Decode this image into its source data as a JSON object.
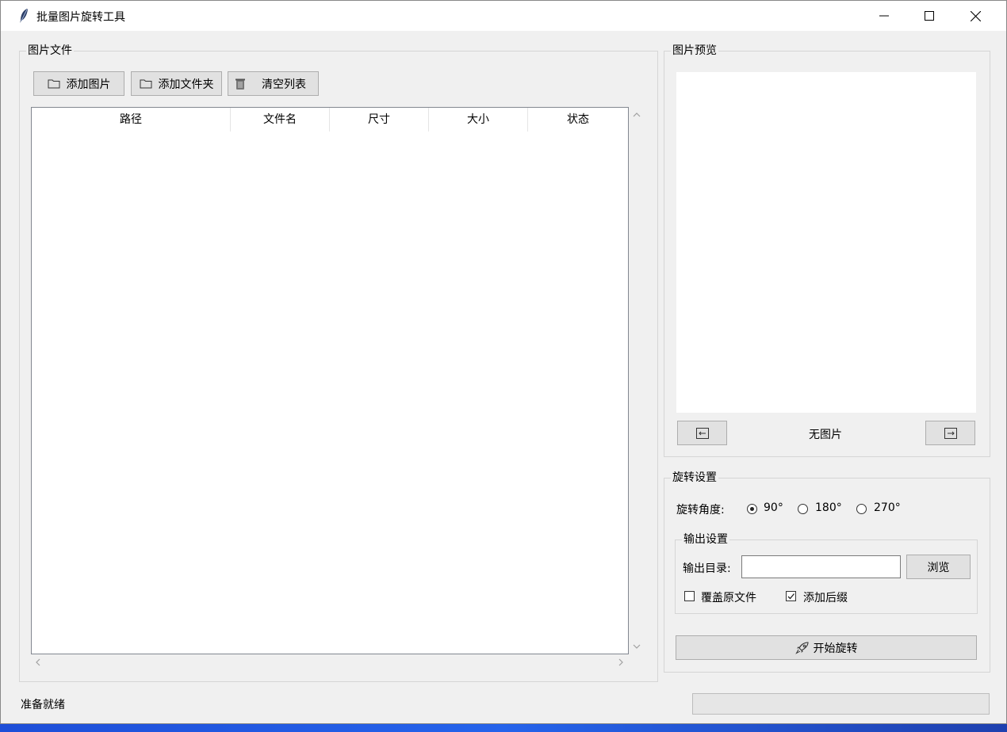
{
  "window": {
    "title": "批量图片旋转工具"
  },
  "files_panel": {
    "title": "图片文件",
    "buttons": {
      "add_images": "添加图片",
      "add_folder": "添加文件夹",
      "clear_list": "清空列表"
    },
    "columns": [
      "路径",
      "文件名",
      "尺寸",
      "大小",
      "状态"
    ],
    "rows": []
  },
  "preview_panel": {
    "title": "图片预览",
    "no_image": "无图片"
  },
  "rotation_panel": {
    "title": "旋转设置",
    "angle_label": "旋转角度:",
    "angles": [
      "90°",
      "180°",
      "270°"
    ],
    "selected_angle": "90°",
    "output": {
      "title": "输出设置",
      "dir_label": "输出目录:",
      "dir_value": "",
      "browse": "浏览",
      "overwrite_label": "覆盖原文件",
      "overwrite_checked": false,
      "suffix_label": "添加后缀",
      "suffix_checked": true
    },
    "start_button": "开始旋转"
  },
  "status": {
    "text": "准备就绪",
    "progress": 0
  }
}
